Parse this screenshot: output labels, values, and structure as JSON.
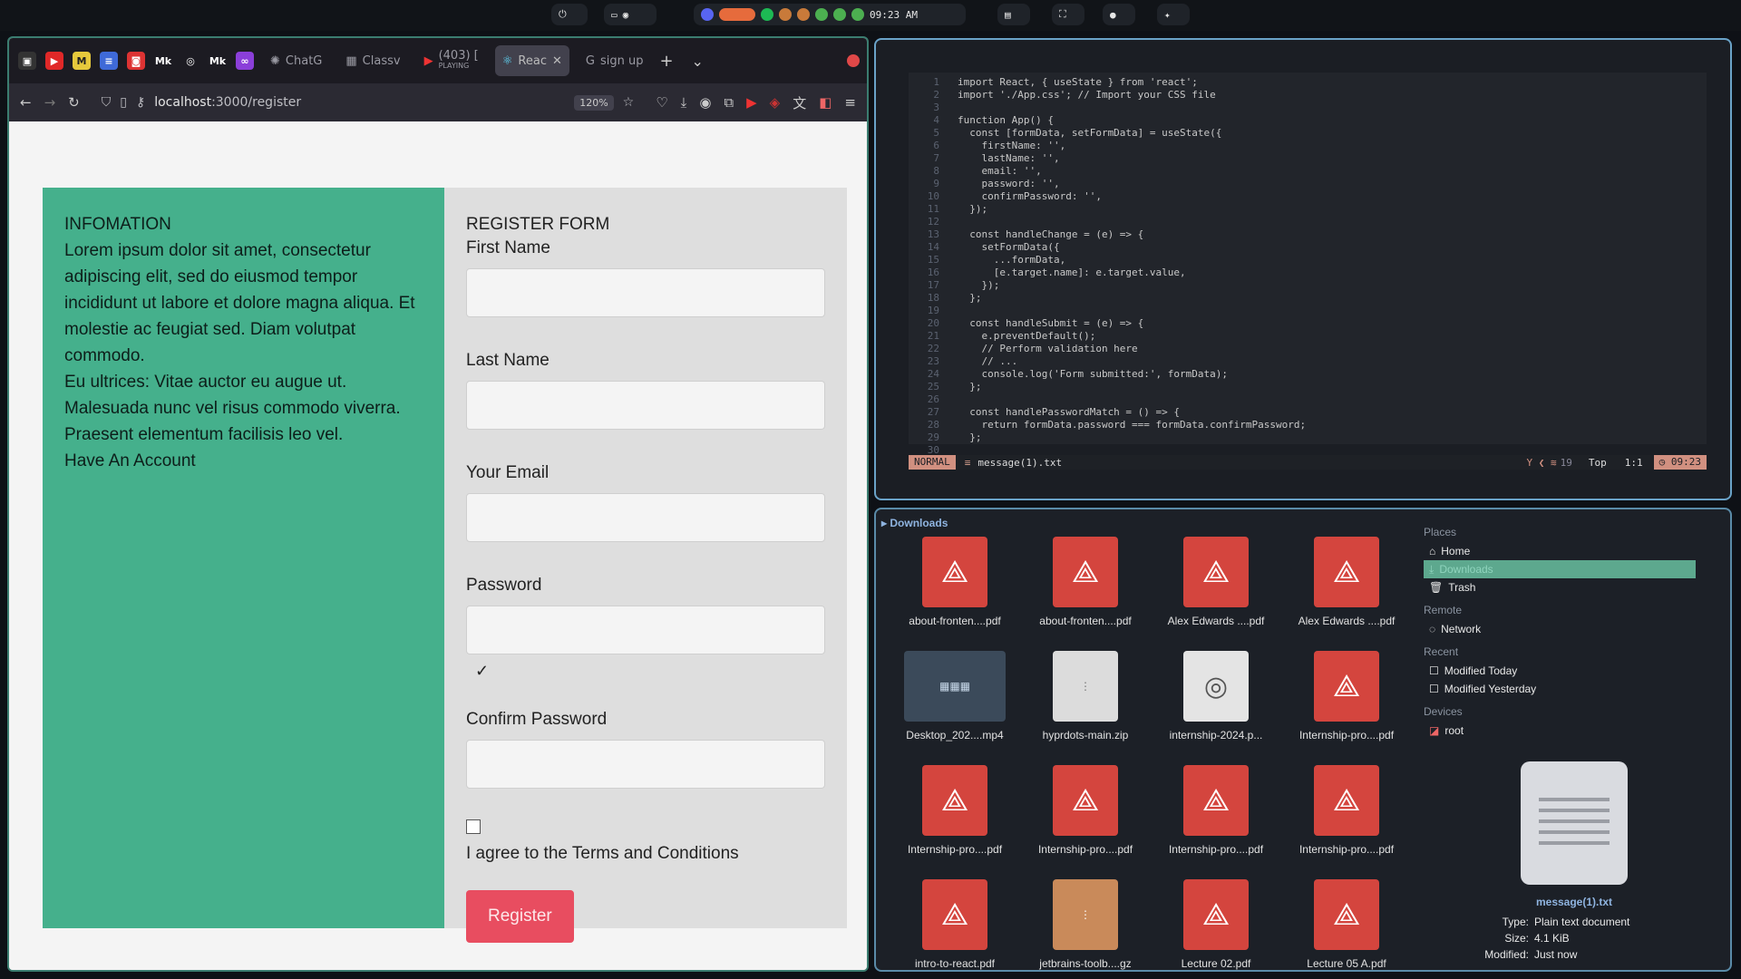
{
  "topbar": {
    "clock": "09:23 AM"
  },
  "browser": {
    "tabs": [
      {
        "label": "ChatG"
      },
      {
        "label": "Classv"
      },
      {
        "label": "(403) [",
        "sub": "PLAYING"
      },
      {
        "label": "Reac",
        "active": true
      },
      {
        "label": "sign up"
      }
    ],
    "url_host": "localhost",
    "url_path": ":3000/register",
    "zoom": "120%"
  },
  "info": {
    "heading": "INFOMATION",
    "para1": "Lorem ipsum dolor sit amet, consectetur adipiscing elit, sed do eiusmod tempor incididunt ut labore et dolore magna aliqua. Et molestie ac feugiat sed. Diam volutpat commodo.",
    "para2": "Eu ultrices: Vitae auctor eu augue ut. Malesuada nunc vel risus commodo viverra. Praesent elementum facilisis leo vel.",
    "link": "Have An Account"
  },
  "form": {
    "heading": "REGISTER FORM",
    "first_name": "First Name",
    "last_name": "Last Name",
    "email": "Your Email",
    "password": "Password",
    "toggle": "✓",
    "confirm": "Confirm Password",
    "terms": "I agree to the Terms and Conditions",
    "submit": "Register"
  },
  "editor": {
    "lines": [
      "import React, { useState } from 'react';",
      "import './App.css'; // Import your CSS file",
      "",
      "function App() {",
      "  const [formData, setFormData] = useState({",
      "    firstName: '',",
      "    lastName: '',",
      "    email: '',",
      "    password: '',",
      "    confirmPassword: '',",
      "  });",
      "",
      "  const handleChange = (e) => {",
      "    setFormData({",
      "      ...formData,",
      "      [e.target.name]: e.target.value,",
      "    });",
      "  };",
      "",
      "  const handleSubmit = (e) => {",
      "    e.preventDefault();",
      "    // Perform validation here",
      "    // ...",
      "    console.log('Form submitted:', formData);",
      "  };",
      "",
      "  const handlePasswordMatch = () => {",
      "    return formData.password === formData.confirmPassword;",
      "  };",
      ""
    ],
    "mode": "NORMAL",
    "file": "message(1).txt",
    "branch_count": "19",
    "pos_word": "Top",
    "cursor": "1:1",
    "time": "09:23"
  },
  "files": {
    "location": "Downloads",
    "items": [
      {
        "name": "about-fronten....pdf",
        "kind": "pdf"
      },
      {
        "name": "about-fronten....pdf",
        "kind": "pdf"
      },
      {
        "name": "Alex Edwards ....pdf",
        "kind": "pdf"
      },
      {
        "name": "Alex Edwards ....pdf",
        "kind": "pdf"
      },
      {
        "name": "Desktop_202....mp4",
        "kind": "video"
      },
      {
        "name": "hyprdots-main.zip",
        "kind": "zip"
      },
      {
        "name": "internship-2024.p...",
        "kind": "generic"
      },
      {
        "name": "Internship-pro....pdf",
        "kind": "pdf"
      },
      {
        "name": "Internship-pro....pdf",
        "kind": "pdf"
      },
      {
        "name": "Internship-pro....pdf",
        "kind": "pdf"
      },
      {
        "name": "Internship-pro....pdf",
        "kind": "pdf"
      },
      {
        "name": "Internship-pro....pdf",
        "kind": "pdf"
      },
      {
        "name": "intro-to-react.pdf",
        "kind": "pdf"
      },
      {
        "name": "jetbrains-toolb....gz",
        "kind": "gz"
      },
      {
        "name": "Lecture 02.pdf",
        "kind": "pdf"
      },
      {
        "name": "Lecture 05 A.pdf",
        "kind": "pdf"
      }
    ],
    "places": {
      "header": "Places",
      "home": "Home",
      "downloads": "Downloads",
      "trash": "Trash"
    },
    "remote": {
      "header": "Remote",
      "network": "Network"
    },
    "recent": {
      "header": "Recent",
      "today": "Modified Today",
      "yesterday": "Modified Yesterday"
    },
    "devices": {
      "header": "Devices",
      "root": "root"
    },
    "preview": {
      "name": "message(1).txt",
      "type_label": "Type:",
      "type": "Plain text document",
      "size_label": "Size:",
      "size": "4.1 KiB",
      "modified_label": "Modified:",
      "modified": "Just now"
    }
  },
  "colors": {
    "info_bg": "#45b08c",
    "register_btn": "#e84d60",
    "selected_sidebar": "#5da88e"
  }
}
